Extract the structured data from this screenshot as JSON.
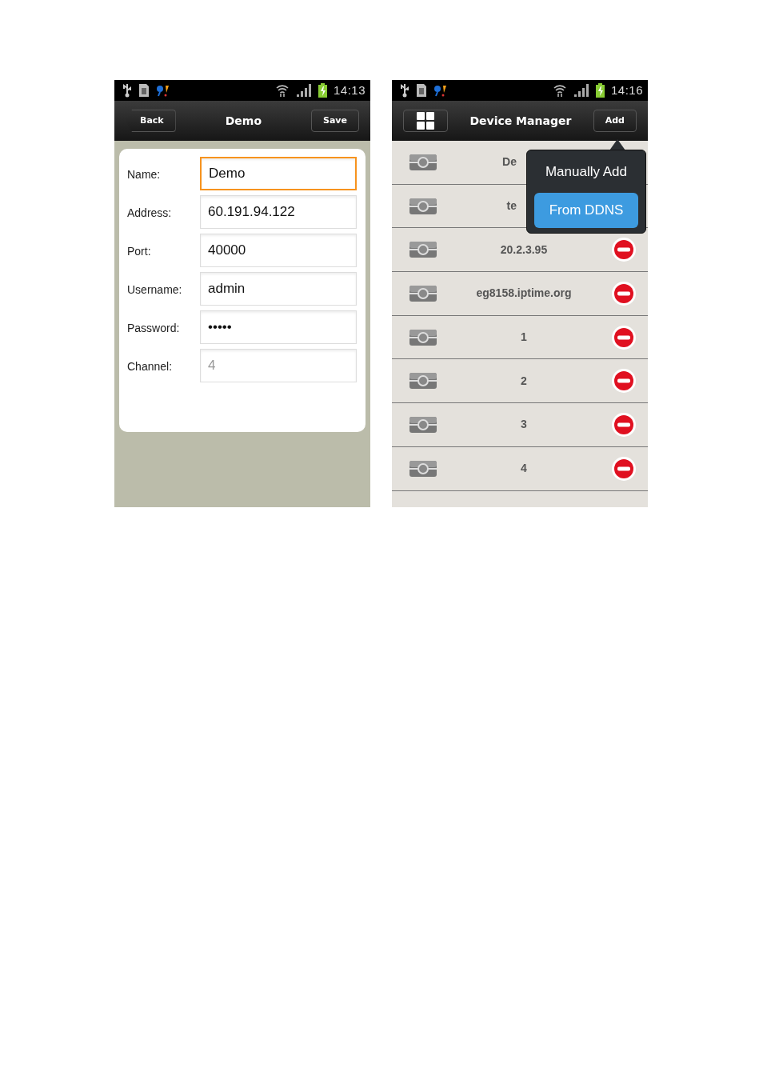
{
  "screens": [
    {
      "kind": "form",
      "status_bar": {
        "time": "14:13"
      },
      "header": {
        "back": "Back",
        "title": "Demo",
        "action": "Save"
      },
      "fields": [
        {
          "label": "Name:",
          "value": "Demo",
          "focused": true
        },
        {
          "label": "Address:",
          "value": "60.191.94.122",
          "focused": false
        },
        {
          "label": "Port:",
          "value": "40000",
          "focused": false
        },
        {
          "label": "Username:",
          "value": "admin",
          "focused": false
        },
        {
          "label": "Password:",
          "value": "•••••",
          "focused": false
        },
        {
          "label": "Channel:",
          "placeholder": "4",
          "focused": false
        }
      ]
    },
    {
      "kind": "list",
      "status_bar": {
        "time": "14:16"
      },
      "header": {
        "title": "Device Manager",
        "action": "Add"
      },
      "devices": [
        {
          "name": "De",
          "covered": true
        },
        {
          "name": "te",
          "covered": true
        },
        {
          "name": "20.2.3.95",
          "covered": false
        },
        {
          "name": "eg8158.iptime.org",
          "covered": false
        },
        {
          "name": "1",
          "covered": false
        },
        {
          "name": "2",
          "covered": false
        },
        {
          "name": "3",
          "covered": false
        },
        {
          "name": "4",
          "covered": false
        }
      ],
      "popup": {
        "items": [
          {
            "label": "Manually Add",
            "selected": false
          },
          {
            "label": "From DDNS",
            "selected": true
          }
        ]
      }
    }
  ]
}
